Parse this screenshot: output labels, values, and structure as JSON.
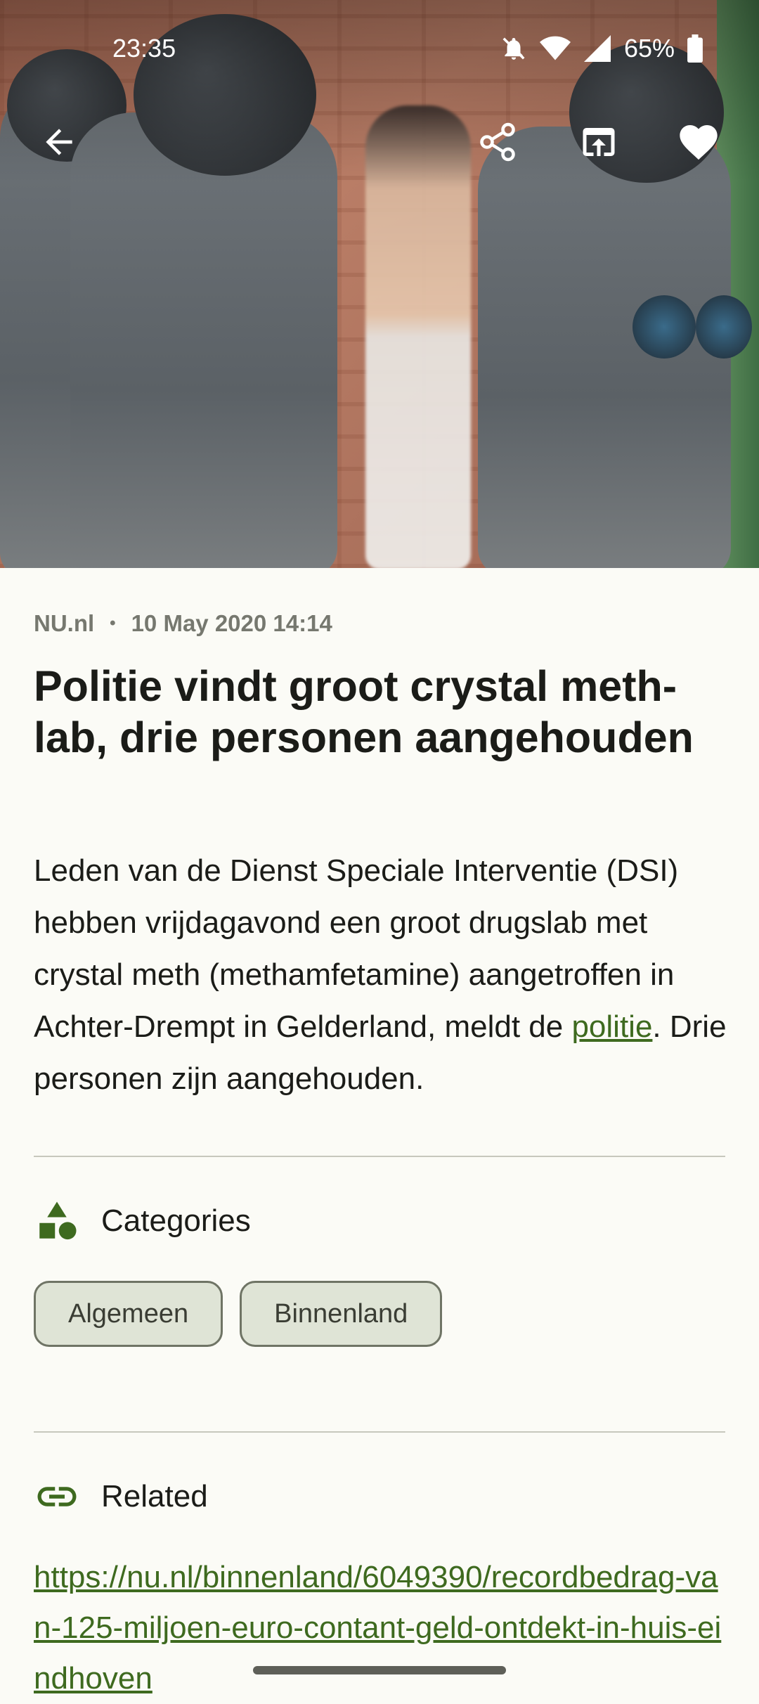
{
  "status_bar": {
    "time": "23:35",
    "battery_percent": "65%",
    "icons": [
      "mute-bell-icon",
      "wifi-icon",
      "signal-icon",
      "battery-icon"
    ]
  },
  "toolbar": {
    "back_icon": "arrow-back-icon",
    "share_icon": "share-icon",
    "open_external_icon": "open-in-browser-icon",
    "favorite_icon": "heart-icon"
  },
  "article": {
    "source": "NU.nl",
    "separator": "•",
    "date": "10 May 2020 14:14",
    "title": "Politie vindt groot crystal meth-lab, drie personen aangehouden",
    "body_before_link": "Leden van de Dienst Speciale Interventie (DSI) hebben vrijdagavond een groot drugslab met crystal meth (methamfetamine) aangetroffen in Achter-Drempt in Gelderland, meldt de ",
    "body_link": "politie",
    "body_after_link": ". Drie personen zijn aangehouden."
  },
  "categories": {
    "heading": "Categories",
    "icon": "category-shapes-icon",
    "items": [
      {
        "label": "Algemeen"
      },
      {
        "label": "Binnenland"
      }
    ]
  },
  "related": {
    "heading": "Related",
    "icon": "link-icon",
    "url": "https://nu.nl/binnenland/6049390/recordbedrag-van-125-miljoen-euro-contant-geld-ontdekt-in-huis-eindhoven"
  },
  "colors": {
    "accent": "#3e6a1f",
    "background": "#fbfbf6",
    "chip_bg": "#dfe4d6"
  }
}
